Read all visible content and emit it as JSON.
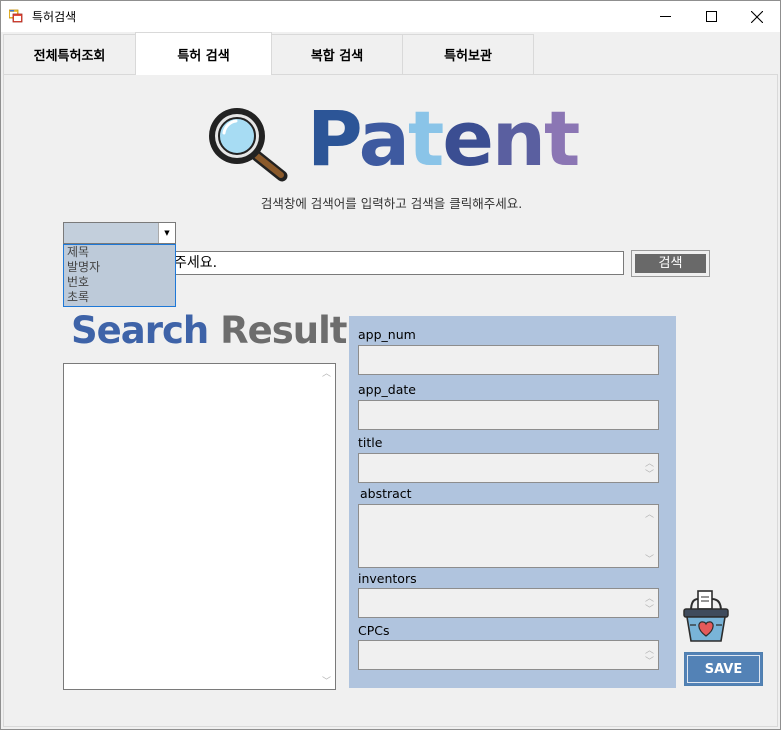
{
  "window": {
    "title": "특허검색",
    "minimize_glyph": "—",
    "maximize_glyph": "☐",
    "close_glyph": "✕"
  },
  "tabs": [
    {
      "label": "전체특허조회",
      "active": false
    },
    {
      "label": "특허 검색",
      "active": true
    },
    {
      "label": "복합 검색",
      "active": false
    },
    {
      "label": "특허보관",
      "active": false
    }
  ],
  "logo": {
    "letters": [
      "P",
      "a",
      "t",
      "e",
      "n",
      "t"
    ],
    "letter_colors": [
      "#2c5597",
      "#3e5aa0",
      "#8ac4e8",
      "#3b4e92",
      "#5a5fa0",
      "#8b76b4"
    ],
    "icon": "magnifier-icon"
  },
  "instruction": "검색창에 검색어를 입력하고 검색을 클릭해주세요.",
  "search": {
    "criteria_options": [
      "제목",
      "발명자",
      "번호",
      "초록"
    ],
    "criteria_selected": "",
    "input_value": "주세요.",
    "button_label": "검색"
  },
  "results": {
    "heading_word1": "Search",
    "heading_word2": "Result",
    "heading_color1": "#3e63a8",
    "heading_color2": "#6d6d6d",
    "items": []
  },
  "details": {
    "app_num_label": "app_num",
    "app_date_label": "app_date",
    "title_label": "title",
    "abstract_label": "abstract",
    "inventors_label": "inventors",
    "cpcs_label": "CPCs",
    "app_num_value": "",
    "app_date_value": "",
    "title_value": "",
    "abstract_value": "",
    "inventors_value": "",
    "cpcs_value": ""
  },
  "save": {
    "label": "SAVE",
    "icon": "basket-heart-icon"
  }
}
